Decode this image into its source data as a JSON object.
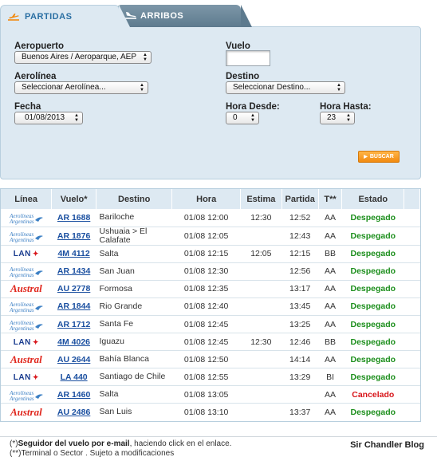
{
  "tabs": {
    "departures_label": "PARTIDAS",
    "arrivals_label": "ARRIBOS"
  },
  "search": {
    "airport_label": "Aeropuerto",
    "airport_value": "Buenos Aires / Aeroparque, AEP",
    "airline_label": "Aerolínea",
    "airline_value": "Seleccionar Aerolínea...",
    "date_label": "Fecha",
    "date_value": "01/08/2013",
    "flight_label": "Vuelo",
    "flight_value": "",
    "destination_label": "Destino",
    "destination_value": "Seleccionar Destino...",
    "hour_from_label": "Hora Desde:",
    "hour_from_value": "0",
    "hour_to_label": "Hora Hasta:",
    "hour_to_value": "23",
    "search_button_label": "BUSCAR"
  },
  "table": {
    "headers": {
      "line": "Línea",
      "flight": "Vuelo*",
      "destination": "Destino",
      "time": "Hora",
      "estimated": "Estima",
      "departure": "Partida",
      "terminal": "T**",
      "status": "Estado"
    },
    "rows": [
      {
        "airline": "aerolineas",
        "flight": "AR 1688",
        "destination": "Bariloche",
        "time": "01/08 12:00",
        "estimated": "12:30",
        "departure": "12:52",
        "terminal": "AA",
        "status": "Despegado",
        "status_type": "ok"
      },
      {
        "airline": "aerolineas",
        "flight": "AR 1876",
        "destination": "Ushuaia > El Calafate",
        "time": "01/08 12:05",
        "estimated": "",
        "departure": "12:43",
        "terminal": "AA",
        "status": "Despegado",
        "status_type": "ok"
      },
      {
        "airline": "lan",
        "flight": "4M 4112",
        "destination": "Salta",
        "time": "01/08 12:15",
        "estimated": "12:05",
        "departure": "12:15",
        "terminal": "BB",
        "status": "Despegado",
        "status_type": "ok"
      },
      {
        "airline": "aerolineas",
        "flight": "AR 1434",
        "destination": "San Juan",
        "time": "01/08 12:30",
        "estimated": "",
        "departure": "12:56",
        "terminal": "AA",
        "status": "Despegado",
        "status_type": "ok"
      },
      {
        "airline": "austral",
        "flight": "AU 2778",
        "destination": "Formosa",
        "time": "01/08 12:35",
        "estimated": "",
        "departure": "13:17",
        "terminal": "AA",
        "status": "Despegado",
        "status_type": "ok"
      },
      {
        "airline": "aerolineas",
        "flight": "AR 1844",
        "destination": "Rio Grande",
        "time": "01/08 12:40",
        "estimated": "",
        "departure": "13:45",
        "terminal": "AA",
        "status": "Despegado",
        "status_type": "ok"
      },
      {
        "airline": "aerolineas",
        "flight": "AR 1712",
        "destination": "Santa Fe",
        "time": "01/08 12:45",
        "estimated": "",
        "departure": "13:25",
        "terminal": "AA",
        "status": "Despegado",
        "status_type": "ok"
      },
      {
        "airline": "lan",
        "flight": "4M 4026",
        "destination": "Iguazu",
        "time": "01/08 12:45",
        "estimated": "12:30",
        "departure": "12:46",
        "terminal": "BB",
        "status": "Despegado",
        "status_type": "ok"
      },
      {
        "airline": "austral",
        "flight": "AU 2644",
        "destination": "Bahía Blanca",
        "time": "01/08 12:50",
        "estimated": "",
        "departure": "14:14",
        "terminal": "AA",
        "status": "Despegado",
        "status_type": "ok"
      },
      {
        "airline": "lan",
        "flight": "LA 440",
        "destination": "Santiago de Chile",
        "time": "01/08 12:55",
        "estimated": "",
        "departure": "13:29",
        "terminal": "BI",
        "status": "Despegado",
        "status_type": "ok"
      },
      {
        "airline": "aerolineas",
        "flight": "AR 1460",
        "destination": "Salta",
        "time": "01/08 13:05",
        "estimated": "",
        "departure": "",
        "terminal": "AA",
        "status": "Cancelado",
        "status_type": "cancel"
      },
      {
        "airline": "austral",
        "flight": "AU 2486",
        "destination": "San Luis",
        "time": "01/08 13:10",
        "estimated": "",
        "departure": "13:37",
        "terminal": "AA",
        "status": "Despegado",
        "status_type": "ok"
      }
    ]
  },
  "logos": {
    "aerolineas_line1": "Aerolíneas",
    "aerolineas_line2": "Argentinas",
    "lan": "LAN",
    "austral": "Austral"
  },
  "footer": {
    "note1_prefix": "(*)",
    "note1_bold": "Seguidor del vuelo por e-mail",
    "note1_rest": ", haciendo click en el enlace.",
    "note2": "(**)Terminal o Sector . Sujeto a modificaciones",
    "credit": "Sir Chandler Blog"
  },
  "colors": {
    "panel_bg": "#dde9f2",
    "tab_active_text": "#2a6fa3",
    "tab_inactive_bg": "#5d7a8e",
    "button_orange": "#f28a10",
    "status_ok": "#1d8f1d",
    "status_cancel": "#d8161b",
    "link_blue": "#1a4fa0"
  }
}
